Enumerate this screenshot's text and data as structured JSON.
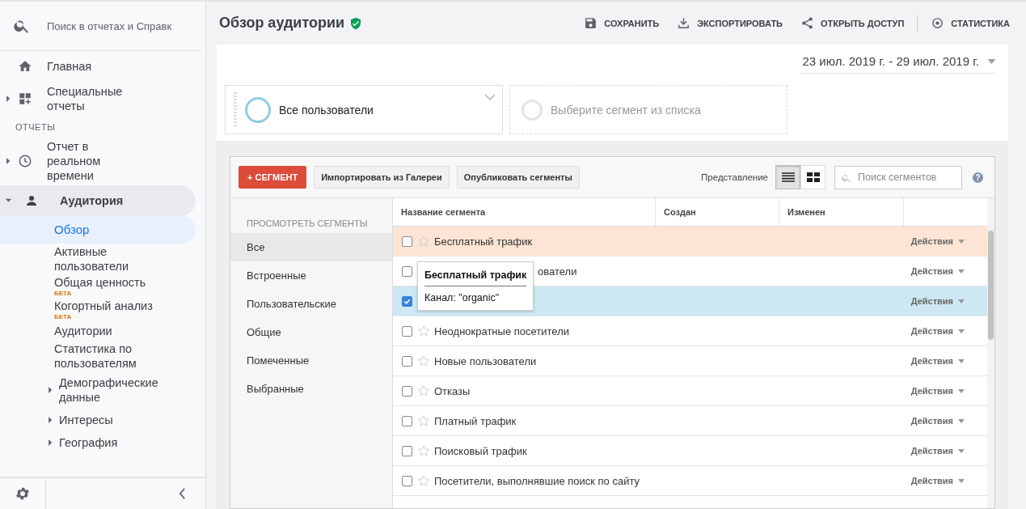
{
  "search": {
    "placeholder": "Поиск в отчетах и Справк"
  },
  "nav": [
    {
      "kind": "link",
      "label": "Главная",
      "active": false
    },
    {
      "kind": "group",
      "label": "Специальные отчеты",
      "expanded": false,
      "active": false
    },
    {
      "kind": "header",
      "label": "ОТЧЕТЫ"
    },
    {
      "kind": "group",
      "label": "Отчет в реальном времени",
      "expanded": false,
      "active": false
    },
    {
      "kind": "group",
      "label": "Аудитория",
      "expanded": true,
      "active": true,
      "children": [
        {
          "kind": "link",
          "label": "Обзор",
          "selected": true
        },
        {
          "kind": "link",
          "label": "Активные пользователи",
          "selected": false
        },
        {
          "kind": "link",
          "label": "Общая ценность",
          "selected": false,
          "badge": "БЕТА"
        },
        {
          "kind": "link",
          "label": "Когортный анализ",
          "selected": false,
          "badge": "БЕТА"
        },
        {
          "kind": "link",
          "label": "Аудитории",
          "selected": false
        },
        {
          "kind": "link",
          "label": "Статистика по пользователям",
          "selected": false
        },
        {
          "kind": "group",
          "label": "Демографические данные",
          "selected": false,
          "expanded": false
        },
        {
          "kind": "group",
          "label": "Интересы",
          "selected": false,
          "expanded": false
        },
        {
          "kind": "group",
          "label": "География",
          "selected": false,
          "expanded": false
        }
      ]
    }
  ],
  "header": {
    "title": "Обзор аудитории",
    "actions": [
      "СОХРАНИТЬ",
      "ЭКСПОРТИРОВАТЬ",
      "ОТКРЫТЬ ДОСТУП",
      "СТАТИСТИКА"
    ]
  },
  "date_range": "23 июл. 2019 г. - 29 июл. 2019 г.",
  "segments": [
    {
      "kind": "active",
      "label": "Все пользователи"
    },
    {
      "kind": "empty",
      "label": "Выберите сегмент из списка"
    }
  ],
  "picker": {
    "new_button": "+ СЕГМЕНТ",
    "buttons": [
      "Импортировать из Галереи",
      "Опубликовать сегменты"
    ],
    "view_label": "Представление",
    "views": [
      {
        "selected": true
      },
      {
        "selected": false
      }
    ],
    "search_placeholder": "Поиск сегментов",
    "help": "?",
    "categories_heading": "ПРОСМОТРЕТЬ СЕГМЕНТЫ",
    "categories": [
      {
        "label": "Все",
        "selected": true
      },
      {
        "label": "Встроенные",
        "selected": false
      },
      {
        "label": "Пользовательские",
        "selected": false
      },
      {
        "label": "Общие",
        "selected": false
      },
      {
        "label": "Помеченные",
        "selected": false
      },
      {
        "label": "Выбранные",
        "selected": false
      }
    ],
    "columns": [
      "Название сегмента",
      "Создан",
      "Изменен"
    ],
    "rows": [
      {
        "name": "Бесплатный трафик",
        "checked": false,
        "hovered": true,
        "covered": false,
        "action": "Действия"
      },
      {
        "name": "ователи",
        "checked": false,
        "hovered": false,
        "covered": true,
        "action": "Действия"
      },
      {
        "checked": true,
        "hovered": false,
        "covered": true,
        "action": "Действия"
      },
      {
        "name": "Неоднократные посетители",
        "checked": false,
        "hovered": false,
        "covered": false,
        "action": "Действия"
      },
      {
        "name": "Новые пользователи",
        "checked": false,
        "hovered": false,
        "covered": false,
        "action": "Действия"
      },
      {
        "name": "Отказы",
        "checked": false,
        "hovered": false,
        "covered": false,
        "action": "Действия"
      },
      {
        "name": "Платный трафик",
        "checked": false,
        "hovered": false,
        "covered": false,
        "action": "Действия"
      },
      {
        "name": "Поисковый трафик",
        "checked": false,
        "hovered": false,
        "covered": false,
        "action": "Действия"
      },
      {
        "name": "Посетители, выполнявшие поиск по сайту",
        "checked": false,
        "hovered": false,
        "covered": false,
        "action": "Действия"
      }
    ],
    "tooltip": {
      "title": "Бесплатный трафик",
      "body": "Канал: \"organic\""
    }
  }
}
